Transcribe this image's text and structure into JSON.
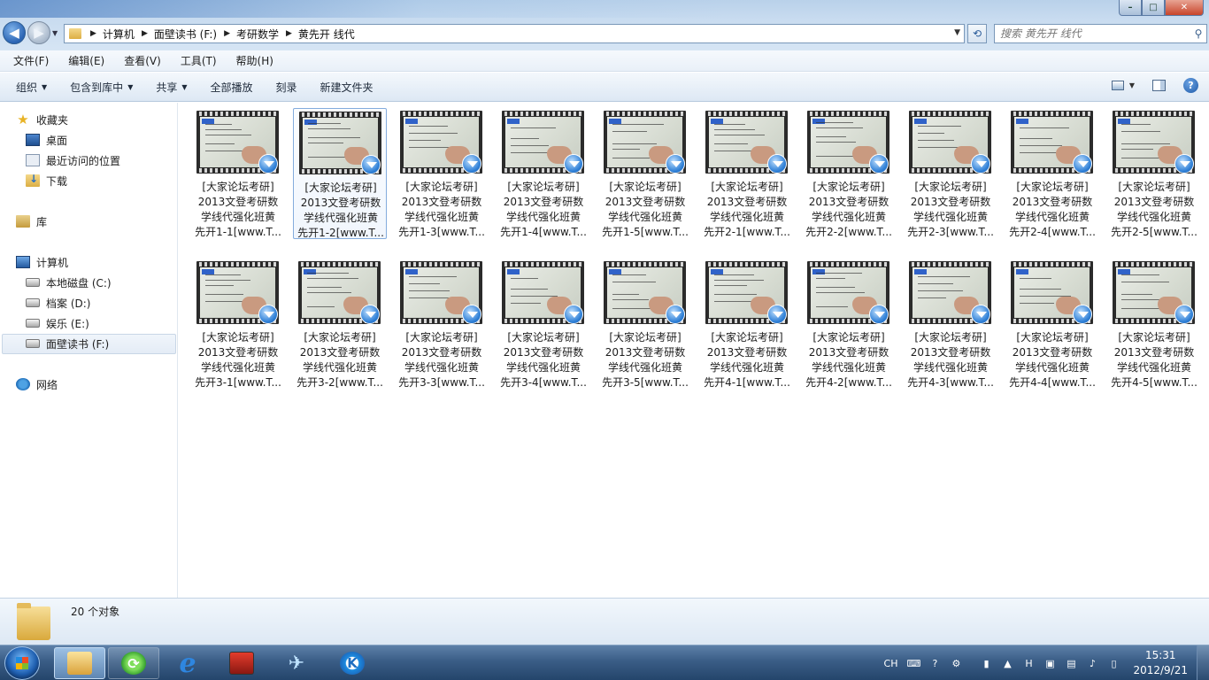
{
  "window": {
    "controls": {
      "minimize": "–",
      "maximize": "□",
      "close": "✕"
    }
  },
  "address": {
    "breadcrumbs": [
      "计算机",
      "面壁读书 (F:)",
      "考研数学",
      "黄先开 线代"
    ]
  },
  "search": {
    "placeholder": "搜索 黄先开 线代"
  },
  "menu": [
    "文件(F)",
    "编辑(E)",
    "查看(V)",
    "工具(T)",
    "帮助(H)"
  ],
  "commands": [
    {
      "label": "组织",
      "dropdown": true
    },
    {
      "label": "包含到库中",
      "dropdown": true
    },
    {
      "label": "共享",
      "dropdown": true
    },
    {
      "label": "全部播放",
      "dropdown": false
    },
    {
      "label": "刻录",
      "dropdown": false
    },
    {
      "label": "新建文件夹",
      "dropdown": false
    }
  ],
  "nav": {
    "favorites": {
      "label": "收藏夹",
      "icon": "star-icon"
    },
    "favorite_items": [
      {
        "label": "桌面",
        "icon": "desktop-icon"
      },
      {
        "label": "最近访问的位置",
        "icon": "recent-places-icon"
      },
      {
        "label": "下载",
        "icon": "downloads-icon"
      }
    ],
    "library": {
      "label": "库",
      "icon": "library-icon"
    },
    "computer": {
      "label": "计算机",
      "icon": "computer-icon"
    },
    "drives": [
      {
        "label": "本地磁盘 (C:)",
        "selected": false
      },
      {
        "label": "档案 (D:)",
        "selected": false
      },
      {
        "label": "娱乐 (E:)",
        "selected": false
      },
      {
        "label": "面壁读书 (F:)",
        "selected": true
      }
    ],
    "network": {
      "label": "网络",
      "icon": "network-icon"
    }
  },
  "files": [
    {
      "line1": "[大家论坛考研]",
      "line2": "2013文登考研数",
      "line3": "学线代强化班黄",
      "line4": "先开1-1[www.T...",
      "selected": false
    },
    {
      "line1": "[大家论坛考研]",
      "line2": "2013文登考研数",
      "line3": "学线代强化班黄",
      "line4": "先开1-2[www.T...",
      "selected": true
    },
    {
      "line1": "[大家论坛考研]",
      "line2": "2013文登考研数",
      "line3": "学线代强化班黄",
      "line4": "先开1-3[www.T...",
      "selected": false
    },
    {
      "line1": "[大家论坛考研]",
      "line2": "2013文登考研数",
      "line3": "学线代强化班黄",
      "line4": "先开1-4[www.T...",
      "selected": false
    },
    {
      "line1": "[大家论坛考研]",
      "line2": "2013文登考研数",
      "line3": "学线代强化班黄",
      "line4": "先开1-5[www.T...",
      "selected": false
    },
    {
      "line1": "[大家论坛考研]",
      "line2": "2013文登考研数",
      "line3": "学线代强化班黄",
      "line4": "先开2-1[www.T...",
      "selected": false
    },
    {
      "line1": "[大家论坛考研]",
      "line2": "2013文登考研数",
      "line3": "学线代强化班黄",
      "line4": "先开2-2[www.T...",
      "selected": false
    },
    {
      "line1": "[大家论坛考研]",
      "line2": "2013文登考研数",
      "line3": "学线代强化班黄",
      "line4": "先开2-3[www.T...",
      "selected": false
    },
    {
      "line1": "[大家论坛考研]",
      "line2": "2013文登考研数",
      "line3": "学线代强化班黄",
      "line4": "先开2-4[www.T...",
      "selected": false
    },
    {
      "line1": "[大家论坛考研]",
      "line2": "2013文登考研数",
      "line3": "学线代强化班黄",
      "line4": "先开2-5[www.T...",
      "selected": false
    },
    {
      "line1": "[大家论坛考研]",
      "line2": "2013文登考研数",
      "line3": "学线代强化班黄",
      "line4": "先开3-1[www.T...",
      "selected": false
    },
    {
      "line1": "[大家论坛考研]",
      "line2": "2013文登考研数",
      "line3": "学线代强化班黄",
      "line4": "先开3-2[www.T...",
      "selected": false
    },
    {
      "line1": "[大家论坛考研]",
      "line2": "2013文登考研数",
      "line3": "学线代强化班黄",
      "line4": "先开3-3[www.T...",
      "selected": false
    },
    {
      "line1": "[大家论坛考研]",
      "line2": "2013文登考研数",
      "line3": "学线代强化班黄",
      "line4": "先开3-4[www.T...",
      "selected": false
    },
    {
      "line1": "[大家论坛考研]",
      "line2": "2013文登考研数",
      "line3": "学线代强化班黄",
      "line4": "先开3-5[www.T...",
      "selected": false
    },
    {
      "line1": "[大家论坛考研]",
      "line2": "2013文登考研数",
      "line3": "学线代强化班黄",
      "line4": "先开4-1[www.T...",
      "selected": false
    },
    {
      "line1": "[大家论坛考研]",
      "line2": "2013文登考研数",
      "line3": "学线代强化班黄",
      "line4": "先开4-2[www.T...",
      "selected": false
    },
    {
      "line1": "[大家论坛考研]",
      "line2": "2013文登考研数",
      "line3": "学线代强化班黄",
      "line4": "先开4-3[www.T...",
      "selected": false
    },
    {
      "line1": "[大家论坛考研]",
      "line2": "2013文登考研数",
      "line3": "学线代强化班黄",
      "line4": "先开4-4[www.T...",
      "selected": false
    },
    {
      "line1": "[大家论坛考研]",
      "line2": "2013文登考研数",
      "line3": "学线代强化班黄",
      "line4": "先开4-5[www.T...",
      "selected": false
    }
  ],
  "status": {
    "count": "20 个对象"
  },
  "taskbar": {
    "apps": [
      {
        "name": "windows-explorer",
        "icon": "folder-icon",
        "active": true
      },
      {
        "name": "sync-app",
        "icon": "sync-icon",
        "active": false
      },
      {
        "name": "internet-explorer",
        "icon": "ie-icon",
        "active": false
      },
      {
        "name": "game-app",
        "icon": "game-icon",
        "active": false
      },
      {
        "name": "bird-app",
        "icon": "bird-icon",
        "active": false
      },
      {
        "name": "k-app",
        "icon": "k-icon",
        "active": false
      }
    ],
    "lang": "CH",
    "time": "15:31",
    "date": "2012/9/21"
  },
  "colors": {
    "accent": "#2a64b4",
    "selection_border": "#84acdd",
    "taskbar": "#3a5d86"
  }
}
